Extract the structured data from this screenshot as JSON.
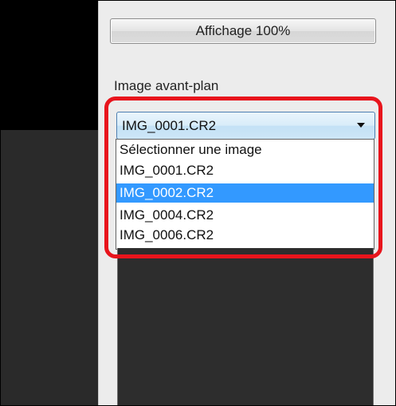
{
  "panel": {
    "zoom_button_label": "Affichage 100%",
    "foreground_label": "Image avant-plan"
  },
  "combo": {
    "selected_value": "IMG_0001.CR2",
    "options": [
      {
        "label": "Sélectionner une image",
        "highlighted": false
      },
      {
        "label": "IMG_0001.CR2",
        "highlighted": false
      },
      {
        "label": "IMG_0002.CR2",
        "highlighted": true
      },
      {
        "label": "IMG_0004.CR2",
        "highlighted": false
      },
      {
        "label": "IMG_0006.CR2",
        "highlighted": false
      }
    ]
  },
  "colors": {
    "highlight_annotation": "#e8141c",
    "selected_option_bg": "#3399ff"
  }
}
